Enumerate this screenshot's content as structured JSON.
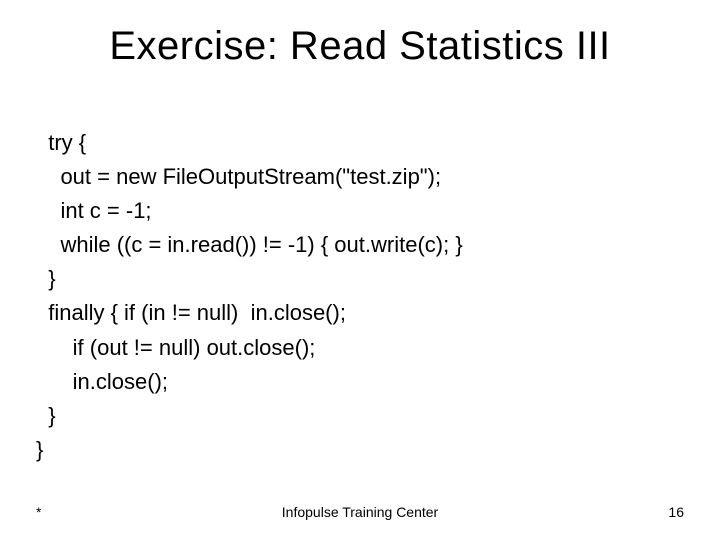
{
  "title": "Exercise: Read Statistics III",
  "code": {
    "l1": "  try {",
    "l2": "    out = new FileOutputStream(\"test.zip\");",
    "l3": "    int c = -1;",
    "l4": "    while ((c = in.read()) != -1) { out.write(c); }",
    "l5": "  }",
    "l6": "  finally { if (in != null)  in.close();",
    "l7": "      if (out != null) out.close();",
    "l8": "      in.close();",
    "l9": "  }",
    "l10": "}"
  },
  "footer": {
    "date": "*",
    "center": "Infopulse Training Center",
    "page": "16"
  }
}
